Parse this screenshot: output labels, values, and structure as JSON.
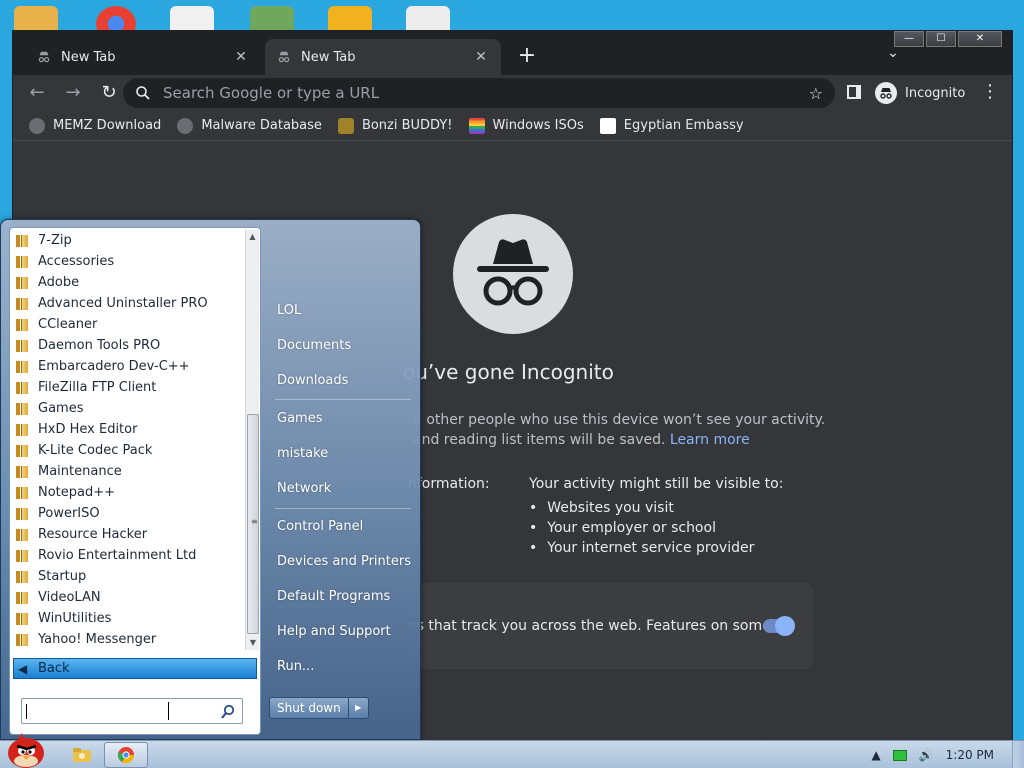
{
  "browser": {
    "tabs": [
      {
        "title": "New Tab",
        "close": "✕"
      },
      {
        "title": "New Tab",
        "close": "✕"
      }
    ],
    "new_tab": "+",
    "tab_search": "⌄",
    "window_buttons": {
      "minimize": "—",
      "maximize": "☐",
      "close": "✕"
    },
    "omnibox_placeholder": "Search Google or type a URL",
    "profile_label": "Incognito",
    "bookmarks": [
      {
        "label": "MEMZ Download",
        "color": "#6b6d72"
      },
      {
        "label": "Malware Database",
        "color": "#6b6d72"
      },
      {
        "label": "Bonzi BUDDY!",
        "color": "#a0822a"
      },
      {
        "label": "Windows ISOs",
        "color": "#e8453c"
      },
      {
        "label": "Egyptian Embassy",
        "color": "#ffffff"
      }
    ]
  },
  "incognito_page": {
    "title": "ou’ve gone Incognito",
    "line1": "d other people who use this device won’t see your activity.",
    "line2": "and reading list items will be saved.",
    "learn_more": "Learn more",
    "left_head": "nformation:",
    "right_head": "Your activity might still be visible to:",
    "visible_to": [
      "Websites you visit",
      "Your employer or school",
      "Your internet service provider"
    ],
    "cookie_text": "es that track you across the web. Features on some"
  },
  "start_menu": {
    "programs": [
      "7-Zip",
      "Accessories",
      "Adobe",
      "Advanced Uninstaller PRO",
      "CCleaner",
      "Daemon Tools PRO",
      "Embarcadero Dev-C++",
      "FileZilla FTP Client",
      "Games",
      "HxD Hex Editor",
      "K-Lite Codec Pack",
      "Maintenance",
      "Notepad++",
      "PowerISO",
      "Resource Hacker",
      "Rovio Entertainment Ltd",
      "Startup",
      "VideoLAN",
      "WinUtilities",
      "Yahoo! Messenger"
    ],
    "back_label": "Back",
    "search_value": "",
    "right_links": {
      "lol": "LOL",
      "documents": "Documents",
      "downloads": "Downloads",
      "games": "Games",
      "mistake": "mistake",
      "network": "Network",
      "control_panel": "Control Panel",
      "devices_printers": "Devices and Printers",
      "default_programs": "Default Programs",
      "help_support": "Help and Support",
      "run": "Run..."
    },
    "shutdown_label": "Shut down"
  },
  "taskbar": {
    "clock": "1:20 PM",
    "tray_arrow": "▲"
  }
}
